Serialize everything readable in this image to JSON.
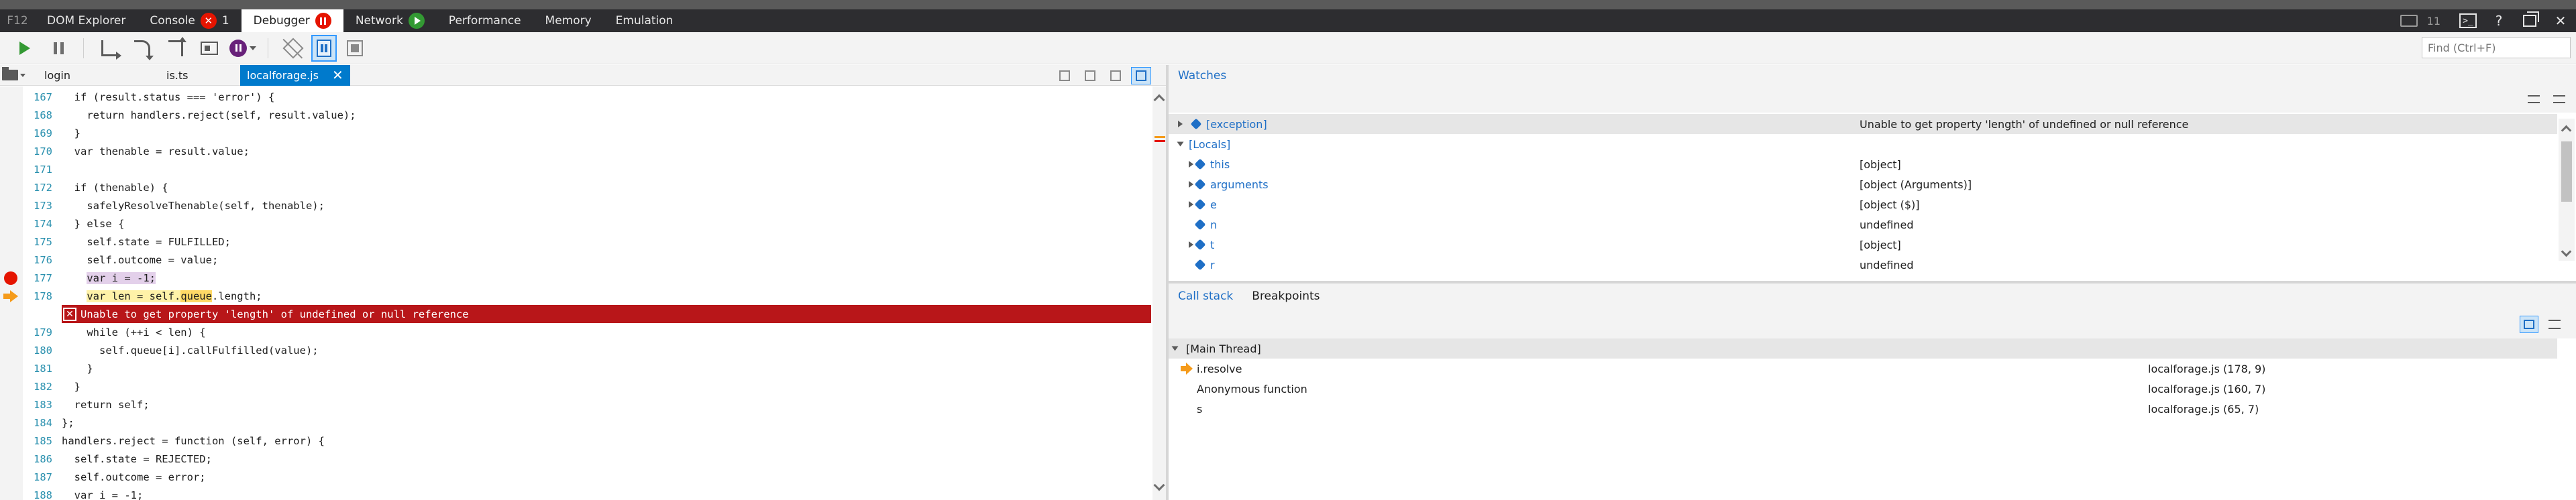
{
  "toptabs": {
    "f12": "F12",
    "items": [
      {
        "label": "DOM Explorer"
      },
      {
        "label": "Console",
        "badge": "1"
      },
      {
        "label": "Debugger"
      },
      {
        "label": "Network"
      },
      {
        "label": "Performance"
      },
      {
        "label": "Memory"
      },
      {
        "label": "Emulation"
      }
    ],
    "emulation_counter": "11"
  },
  "toolbar": {
    "find_placeholder": "Find (Ctrl+F)"
  },
  "filetabs": {
    "items": [
      {
        "label": "login"
      },
      {
        "label": "is.ts"
      },
      {
        "label": "localforage.js",
        "close": "✕"
      }
    ]
  },
  "editor": {
    "lines": [
      {
        "n": "167",
        "text": "  if (result.status === 'error') {"
      },
      {
        "n": "168",
        "text": "    return handlers.reject(self, result.value);"
      },
      {
        "n": "169",
        "text": "  }"
      },
      {
        "n": "170",
        "text": "  var thenable = result.value;"
      },
      {
        "n": "171",
        "text": ""
      },
      {
        "n": "172",
        "text": "  if (thenable) {"
      },
      {
        "n": "173",
        "text": "    safelyResolveThenable(self, thenable);"
      },
      {
        "n": "174",
        "text": "  } else {"
      },
      {
        "n": "175",
        "text": "    self.state = FULFILLED;"
      },
      {
        "n": "176",
        "text": "    self.outcome = value;"
      },
      {
        "n": "177",
        "pre": "    ",
        "hl": "var i = -1;",
        "post": ""
      },
      {
        "n": "178",
        "pre": "    ",
        "hl": "var len = self.",
        "hl2": "queue",
        "post": ".length;"
      },
      {
        "n": "179",
        "text": "    while (++i < len) {"
      },
      {
        "n": "180",
        "text": "      self.queue[i].callFulfilled(value);"
      },
      {
        "n": "181",
        "text": "    }"
      },
      {
        "n": "182",
        "text": "  }"
      },
      {
        "n": "183",
        "text": "  return self;"
      },
      {
        "n": "184",
        "text": "};"
      },
      {
        "n": "185",
        "text": "handlers.reject = function (self, error) {"
      },
      {
        "n": "186",
        "text": "  self.state = REJECTED;"
      },
      {
        "n": "187",
        "text": "  self.outcome = error;"
      },
      {
        "n": "188",
        "text": "  var i = -1;"
      }
    ],
    "error_message": "Unable to get property 'length' of undefined or null reference"
  },
  "watches": {
    "title": "Watches",
    "rows": [
      {
        "name": "[exception]",
        "value": "Unable to get property 'length' of undefined or null reference"
      },
      {
        "name": "[Locals]",
        "value": ""
      },
      {
        "name": "this",
        "value": "[object]"
      },
      {
        "name": "arguments",
        "value": "[object (Arguments)]"
      },
      {
        "name": "e",
        "value": "[object ($)]"
      },
      {
        "name": "n",
        "value": "undefined"
      },
      {
        "name": "t",
        "value": "[object]"
      },
      {
        "name": "r",
        "value": "undefined"
      }
    ]
  },
  "callstack": {
    "tabs": [
      {
        "label": "Call stack"
      },
      {
        "label": "Breakpoints"
      }
    ],
    "thread": "[Main Thread]",
    "frames": [
      {
        "fn": "i.resolve",
        "loc": "localforage.js (178, 9)"
      },
      {
        "fn": "Anonymous function",
        "loc": "localforage.js (160, 7)"
      },
      {
        "fn": "s",
        "loc": "localforage.js (65, 7)"
      }
    ]
  }
}
